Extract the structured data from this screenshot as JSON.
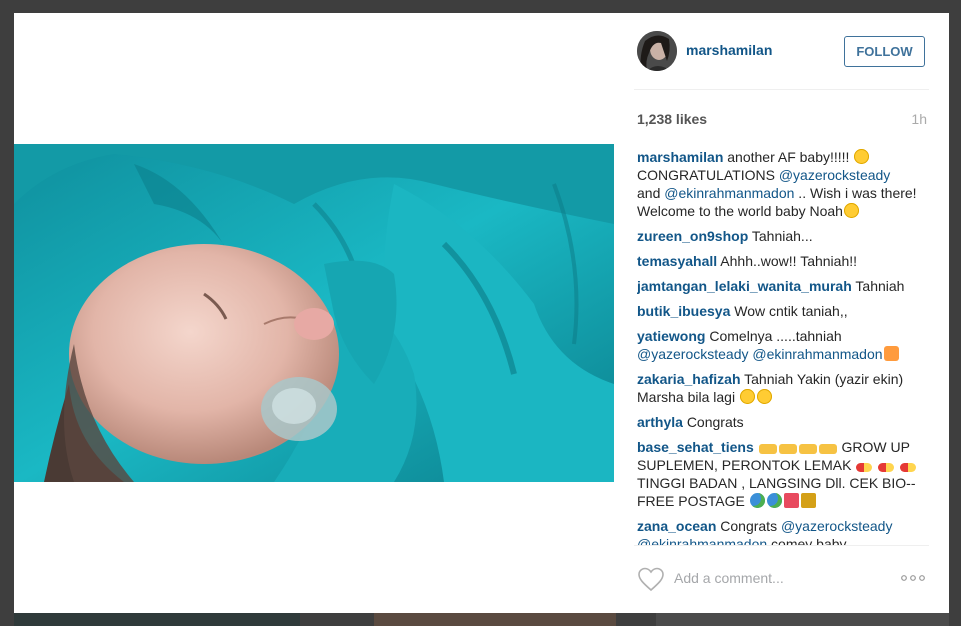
{
  "post": {
    "username": "marshamilan",
    "follow_label": "FOLLOW",
    "likes": "1,238 likes",
    "time": "1h"
  },
  "comments": [
    {
      "user": "marshamilan",
      "text1": "another AF baby!!!!! ",
      "line2": "CONGRATULATIONS ",
      "mention1": "@yazerocksteady",
      "text2": "and ",
      "mention2": "@ekinrahmanmadon",
      "text3": " .. Wish i was there! Welcome to the world baby Noah"
    },
    {
      "user": "zureen_on9shop",
      "text": "Tahniah..."
    },
    {
      "user": "temasyahall",
      "text": "Ahhh..wow!! Tahniah!!"
    },
    {
      "user": "jamtangan_lelaki_wanita_murah",
      "text": "Tahniah"
    },
    {
      "user": "butik_ibuesya",
      "text": "Wow cntik taniah,,"
    },
    {
      "user": "yatiewong",
      "text": "Comelnya .....tahniah",
      "mention1": "@yazerocksteady",
      "mention2": "@ekinrahmanmadon"
    },
    {
      "user": "zakaria_hafizah",
      "text": "Tahniah Yakin (yazir ekin) Marsha bila lagi"
    },
    {
      "user": "arthyla",
      "text": "Congrats"
    },
    {
      "user": "base_sehat_tiens",
      "text1": "GROW UP SUPLEMEN, PERONTOK LEMAK",
      "text2": "TINGGI BADAN , LANGSING Dll. CEK BIO--FREE POSTAGE"
    },
    {
      "user": "zana_ocean",
      "text": "Congrats",
      "mention1": "@yazerocksteady",
      "mention2": "@ekinrahmanmadon",
      "text2": " comey baby"
    }
  ],
  "add_comment": {
    "placeholder": "Add a comment..."
  },
  "icons": {
    "like": "heart-icon",
    "more": "more-options-icon"
  },
  "colors": {
    "link": "#125688",
    "follow": "#3f729b",
    "photo_blanket": "#16a8b4"
  }
}
